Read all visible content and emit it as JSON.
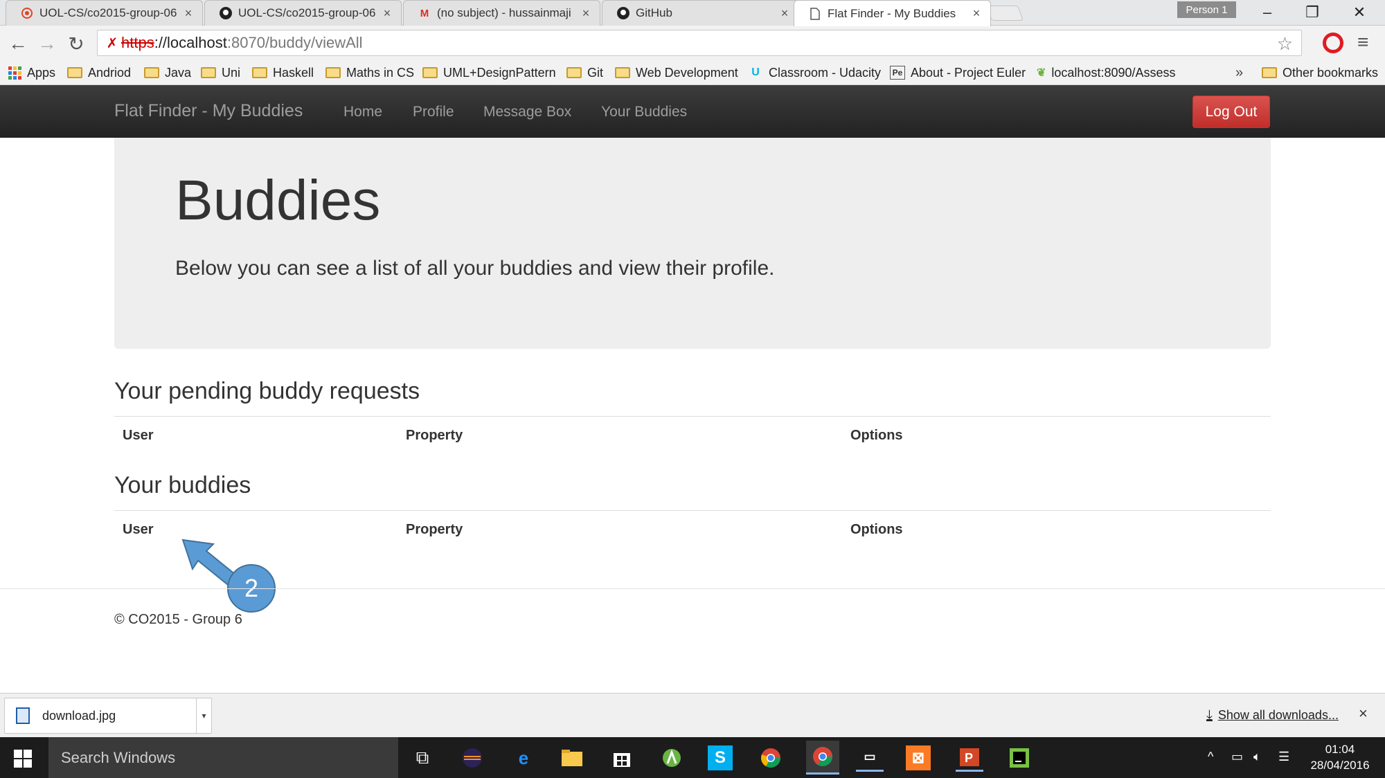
{
  "browser": {
    "tabs": [
      {
        "title": "UOL-CS/co2015-group-06",
        "icon": "gitlab-icon",
        "active": false
      },
      {
        "title": "UOL-CS/co2015-group-06",
        "icon": "github-icon",
        "active": false
      },
      {
        "title": "(no subject) - hussainmaji",
        "icon": "gmail-icon",
        "active": false
      },
      {
        "title": "GitHub",
        "icon": "github-icon",
        "active": false
      },
      {
        "title": "Flat Finder - My Buddies",
        "icon": "page-icon",
        "active": true
      }
    ],
    "person_badge": "Person 1",
    "url": {
      "scheme": "https",
      "host": "://localhost",
      "path": ":8070/buddy/viewAll"
    },
    "bookmarks": [
      {
        "label": "Apps",
        "icon": "apps-grid-icon"
      },
      {
        "label": "Andriod",
        "icon": "folder-icon"
      },
      {
        "label": "Java",
        "icon": "folder-icon"
      },
      {
        "label": "Uni",
        "icon": "folder-icon"
      },
      {
        "label": "Haskell",
        "icon": "folder-icon"
      },
      {
        "label": "Maths in CS",
        "icon": "folder-icon"
      },
      {
        "label": "UML+DesignPattern",
        "icon": "folder-icon"
      },
      {
        "label": "Git",
        "icon": "folder-icon"
      },
      {
        "label": "Web Development",
        "icon": "folder-icon"
      },
      {
        "label": "Classroom - Udacity",
        "icon": "udacity-icon"
      },
      {
        "label": "About - Project Euler",
        "icon": "project-euler-icon"
      },
      {
        "label": "localhost:8090/Assess",
        "icon": "leaf-icon"
      },
      {
        "label": "Other bookmarks",
        "icon": "folder-icon"
      }
    ],
    "bookmarks_more": "»"
  },
  "navbar": {
    "brand": "Flat Finder - My Buddies",
    "links": [
      "Home",
      "Profile",
      "Message Box",
      "Your Buddies"
    ],
    "logout": "Log Out"
  },
  "jumbotron": {
    "title": "Buddies",
    "subtitle": "Below you can see a list of all your buddies and view their profile."
  },
  "pending": {
    "heading": "Your pending buddy requests",
    "columns": [
      "User",
      "Property",
      "Options"
    ]
  },
  "buddies": {
    "heading": "Your buddies",
    "columns": [
      "User",
      "Property",
      "Options"
    ]
  },
  "annotation": {
    "number": "2",
    "color": "#5b9bd5"
  },
  "footer": {
    "text": "© CO2015 - Group 6"
  },
  "downloads": {
    "file": "download.jpg",
    "show_all": "Show all downloads...",
    "close": "×"
  },
  "taskbar": {
    "search_placeholder": "Search Windows",
    "time": "01:04",
    "date": "28/04/2016"
  },
  "colors": {
    "navbar_bg": "#222222",
    "logout_bg": "#d9534f",
    "jumbotron_bg": "#eeeeee",
    "annotation": "#5b9bd5"
  }
}
